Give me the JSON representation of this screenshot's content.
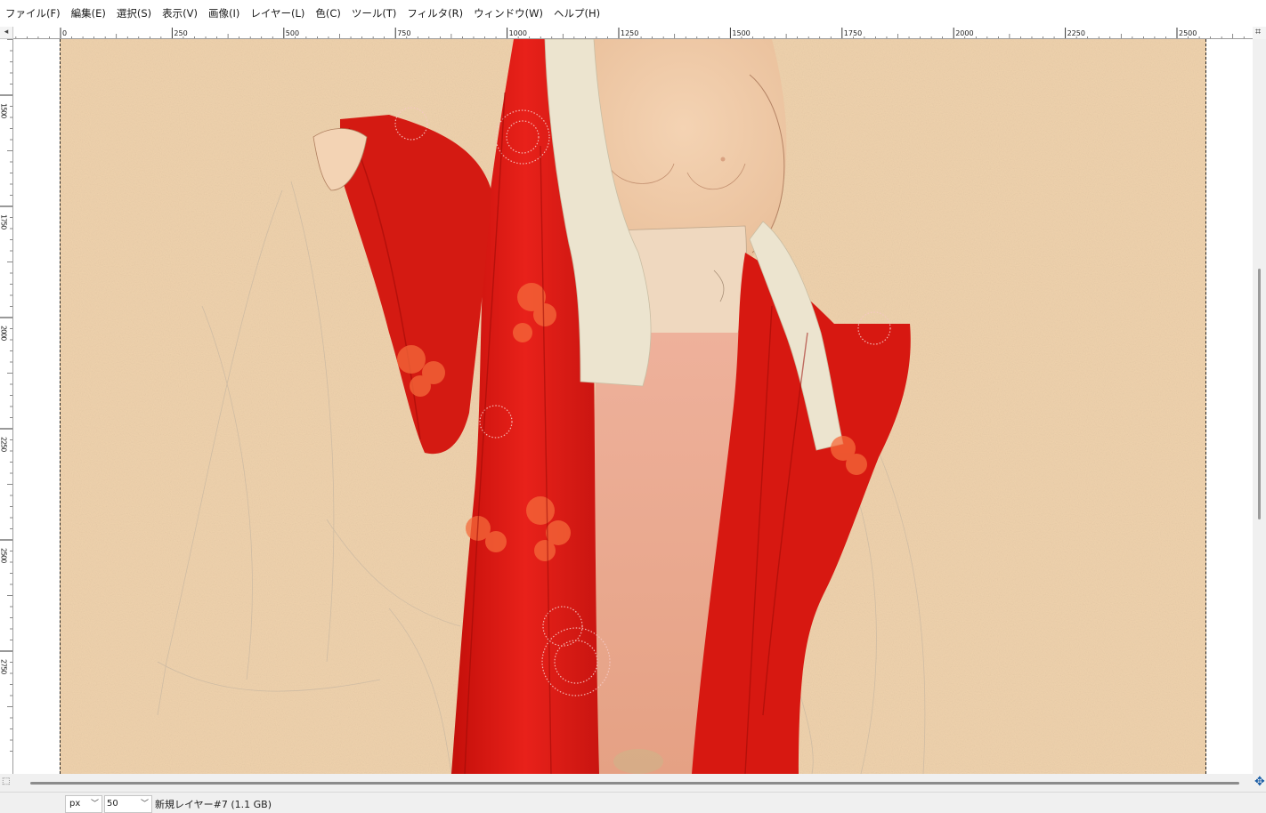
{
  "menubar": {
    "items": [
      {
        "label": "ファイル(F)"
      },
      {
        "label": "編集(E)"
      },
      {
        "label": "選択(S)"
      },
      {
        "label": "表示(V)"
      },
      {
        "label": "画像(I)"
      },
      {
        "label": "レイヤー(L)"
      },
      {
        "label": "色(C)"
      },
      {
        "label": "ツール(T)"
      },
      {
        "label": "フィルタ(R)"
      },
      {
        "label": "ウィンドウ(W)"
      },
      {
        "label": "ヘルプ(H)"
      }
    ]
  },
  "rulers": {
    "horizontal_labels": [
      "0",
      "250",
      "500",
      "750",
      "1000",
      "1250",
      "1500",
      "1750",
      "2000",
      "2250",
      "2500"
    ],
    "vertical_labels": [
      "1500",
      "1750",
      "2000",
      "2250",
      "2500",
      "2750"
    ]
  },
  "statusbar": {
    "unit": "px",
    "zoom": "50",
    "layer_info": "新規レイヤー#7 (1.1 GB)"
  },
  "colors": {
    "canvas_bg": "#efd1ac",
    "kimono_red": "#e01a12",
    "underrobe_pink": "#e9a58e",
    "collar_white": "#ece4cf",
    "skin": "#f0caa6"
  },
  "icons": {
    "quick_mask": "quick-mask-icon",
    "navigate": "navigate-icon",
    "ruler_corner": "ruler-corner-icon"
  }
}
